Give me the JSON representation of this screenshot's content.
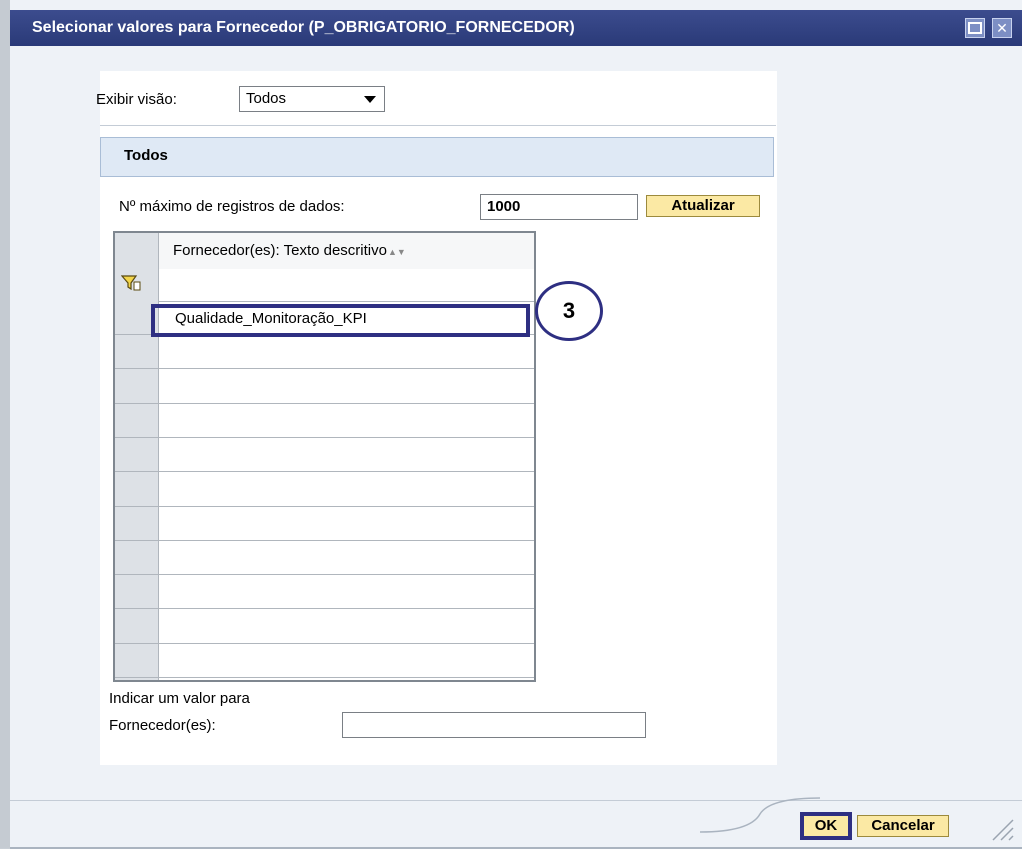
{
  "window": {
    "title": "Selecionar valores para Fornecedor (P_OBRIGATORIO_FORNECEDOR)",
    "maximize_icon": "maximize-icon",
    "close_icon": "close-icon"
  },
  "view": {
    "label": "Exibir visão:",
    "selected": "Todos"
  },
  "section": {
    "title": "Todos"
  },
  "max_records": {
    "label": "Nº máximo de registros de dados:",
    "value": "1000",
    "refresh_label": "Atualizar"
  },
  "grid": {
    "column_header": "Fornecedor(es): Texto descritivo",
    "sort_icon": "sort-icon",
    "filter_icon": "filter-icon",
    "rows": [
      "Qualidade_Monitoração_KPI",
      "",
      "",
      "",
      "",
      "",
      "",
      "",
      "",
      "",
      ""
    ]
  },
  "annotation": {
    "callout": "3"
  },
  "indicate": {
    "label_line1": "Indicar um valor para",
    "label_line2": "Fornecedor(es):",
    "value": ""
  },
  "footer": {
    "ok_label": "OK",
    "cancel_label": "Cancelar"
  },
  "colors": {
    "titlebar": "#2f3f7e",
    "accent_box": "#2e2f82",
    "button_yellow": "#fbe9a4",
    "section_header": "#dfe9f5"
  }
}
